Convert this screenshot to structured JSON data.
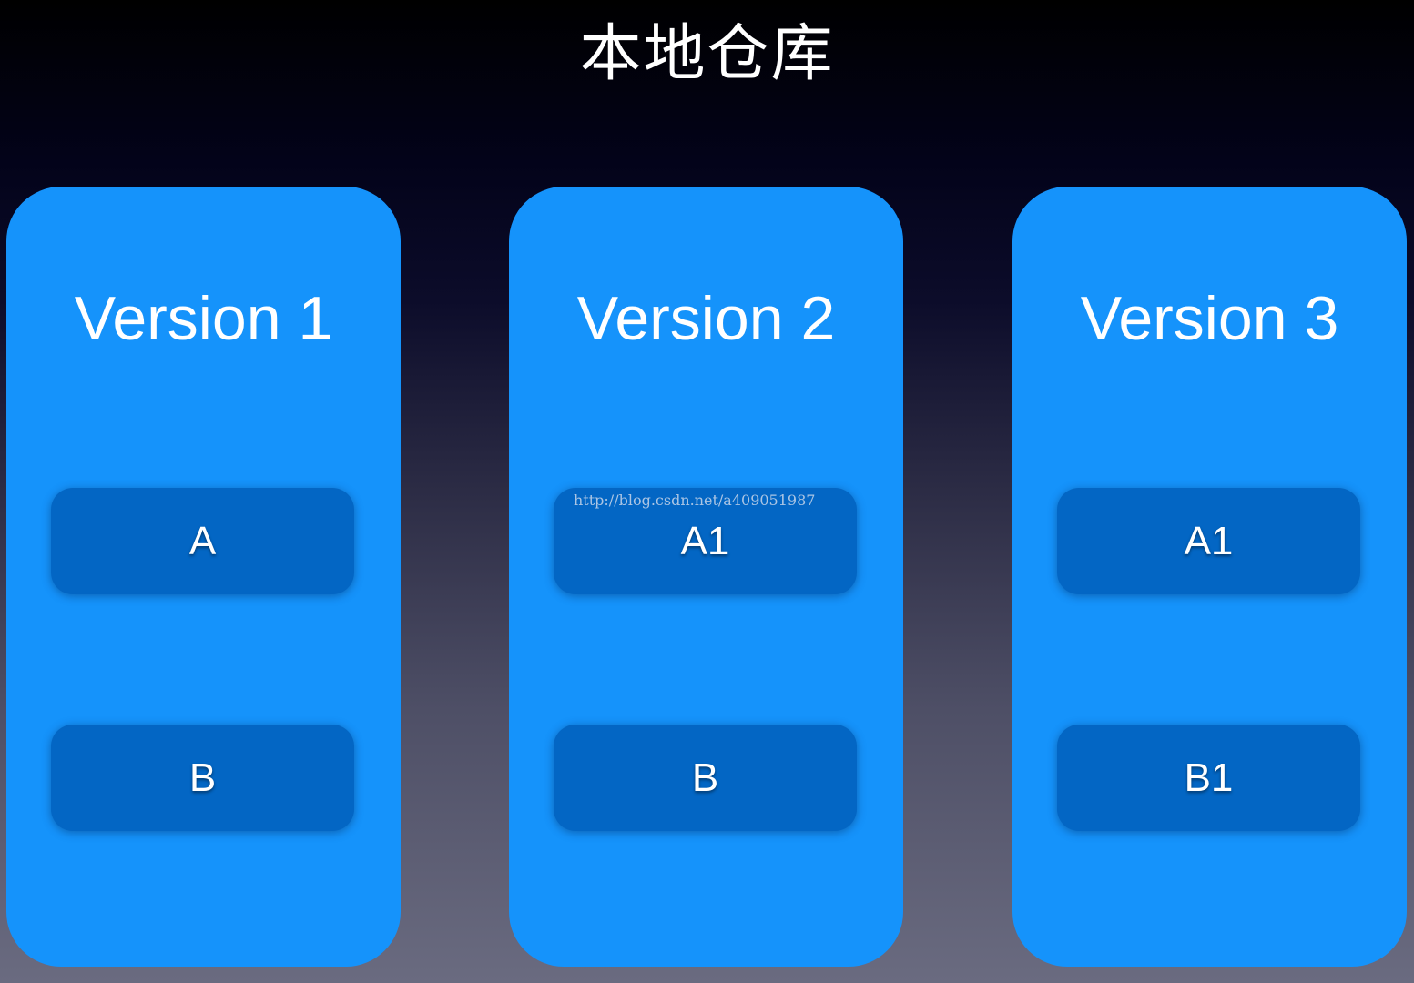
{
  "title": "本地仓库",
  "versions": [
    {
      "label": "Version 1",
      "files": [
        "A",
        "B"
      ]
    },
    {
      "label": "Version 2",
      "files": [
        "A1",
        "B"
      ]
    },
    {
      "label": "Version 3",
      "files": [
        "A1",
        "B1"
      ]
    }
  ],
  "watermark": "http://blog.csdn.net/a409051987",
  "colors": {
    "column": "#1593fb",
    "file_box": "#0366c4",
    "text": "#ffffff"
  }
}
